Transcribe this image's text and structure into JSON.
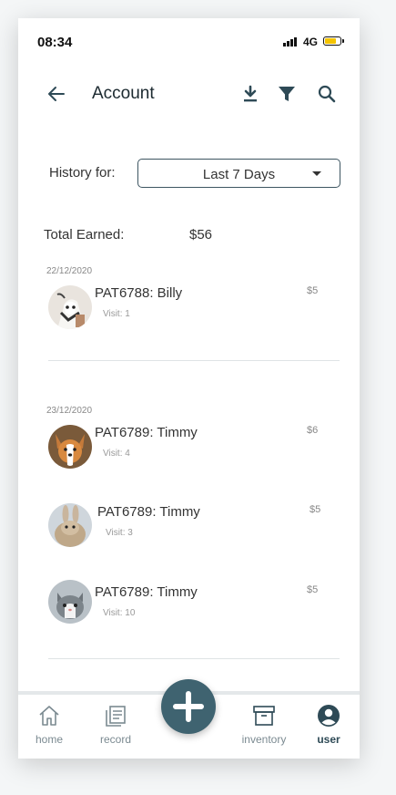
{
  "status": {
    "time": "08:34",
    "network": "4G",
    "battery_level": 0.8
  },
  "header": {
    "title": "Account"
  },
  "filter": {
    "label": "History for:",
    "selected": "Last 7 Days"
  },
  "summary": {
    "label": "Total Earned:",
    "value": "$56"
  },
  "groups": [
    {
      "date": "22/12/2020",
      "entries": [
        {
          "name": "PAT6788: Billy",
          "visit": "Visit: 1",
          "amount": "$5",
          "avatar": "goat"
        }
      ]
    },
    {
      "date": "23/12/2020",
      "entries": [
        {
          "name": "PAT6789: Timmy",
          "visit": "Visit: 4",
          "amount": "$6",
          "avatar": "dog"
        },
        {
          "name": "PAT6789: Timmy",
          "visit": "Visit: 3",
          "amount": "$5",
          "avatar": "rabbit"
        },
        {
          "name": "PAT6789: Timmy",
          "visit": "Visit: 10",
          "amount": "$5",
          "avatar": "cat"
        }
      ]
    }
  ],
  "tabbar": {
    "home": "home",
    "record": "record",
    "inventory": "inventory",
    "user": "user",
    "active": "user"
  },
  "colors": {
    "accent": "#3f6370",
    "icon": "#2e4a56"
  }
}
